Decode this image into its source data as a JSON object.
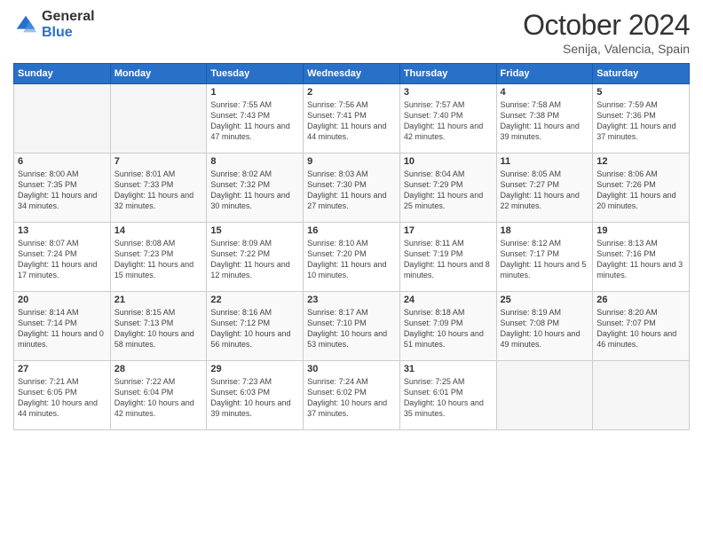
{
  "logo": {
    "general": "General",
    "blue": "Blue"
  },
  "header": {
    "month": "October 2024",
    "location": "Senija, Valencia, Spain"
  },
  "weekdays": [
    "Sunday",
    "Monday",
    "Tuesday",
    "Wednesday",
    "Thursday",
    "Friday",
    "Saturday"
  ],
  "weeks": [
    [
      {
        "day": "",
        "sunrise": "",
        "sunset": "",
        "daylight": "",
        "empty": true
      },
      {
        "day": "",
        "sunrise": "",
        "sunset": "",
        "daylight": "",
        "empty": true
      },
      {
        "day": "1",
        "sunrise": "Sunrise: 7:55 AM",
        "sunset": "Sunset: 7:43 PM",
        "daylight": "Daylight: 11 hours and 47 minutes.",
        "empty": false
      },
      {
        "day": "2",
        "sunrise": "Sunrise: 7:56 AM",
        "sunset": "Sunset: 7:41 PM",
        "daylight": "Daylight: 11 hours and 44 minutes.",
        "empty": false
      },
      {
        "day": "3",
        "sunrise": "Sunrise: 7:57 AM",
        "sunset": "Sunset: 7:40 PM",
        "daylight": "Daylight: 11 hours and 42 minutes.",
        "empty": false
      },
      {
        "day": "4",
        "sunrise": "Sunrise: 7:58 AM",
        "sunset": "Sunset: 7:38 PM",
        "daylight": "Daylight: 11 hours and 39 minutes.",
        "empty": false
      },
      {
        "day": "5",
        "sunrise": "Sunrise: 7:59 AM",
        "sunset": "Sunset: 7:36 PM",
        "daylight": "Daylight: 11 hours and 37 minutes.",
        "empty": false
      }
    ],
    [
      {
        "day": "6",
        "sunrise": "Sunrise: 8:00 AM",
        "sunset": "Sunset: 7:35 PM",
        "daylight": "Daylight: 11 hours and 34 minutes.",
        "empty": false
      },
      {
        "day": "7",
        "sunrise": "Sunrise: 8:01 AM",
        "sunset": "Sunset: 7:33 PM",
        "daylight": "Daylight: 11 hours and 32 minutes.",
        "empty": false
      },
      {
        "day": "8",
        "sunrise": "Sunrise: 8:02 AM",
        "sunset": "Sunset: 7:32 PM",
        "daylight": "Daylight: 11 hours and 30 minutes.",
        "empty": false
      },
      {
        "day": "9",
        "sunrise": "Sunrise: 8:03 AM",
        "sunset": "Sunset: 7:30 PM",
        "daylight": "Daylight: 11 hours and 27 minutes.",
        "empty": false
      },
      {
        "day": "10",
        "sunrise": "Sunrise: 8:04 AM",
        "sunset": "Sunset: 7:29 PM",
        "daylight": "Daylight: 11 hours and 25 minutes.",
        "empty": false
      },
      {
        "day": "11",
        "sunrise": "Sunrise: 8:05 AM",
        "sunset": "Sunset: 7:27 PM",
        "daylight": "Daylight: 11 hours and 22 minutes.",
        "empty": false
      },
      {
        "day": "12",
        "sunrise": "Sunrise: 8:06 AM",
        "sunset": "Sunset: 7:26 PM",
        "daylight": "Daylight: 11 hours and 20 minutes.",
        "empty": false
      }
    ],
    [
      {
        "day": "13",
        "sunrise": "Sunrise: 8:07 AM",
        "sunset": "Sunset: 7:24 PM",
        "daylight": "Daylight: 11 hours and 17 minutes.",
        "empty": false
      },
      {
        "day": "14",
        "sunrise": "Sunrise: 8:08 AM",
        "sunset": "Sunset: 7:23 PM",
        "daylight": "Daylight: 11 hours and 15 minutes.",
        "empty": false
      },
      {
        "day": "15",
        "sunrise": "Sunrise: 8:09 AM",
        "sunset": "Sunset: 7:22 PM",
        "daylight": "Daylight: 11 hours and 12 minutes.",
        "empty": false
      },
      {
        "day": "16",
        "sunrise": "Sunrise: 8:10 AM",
        "sunset": "Sunset: 7:20 PM",
        "daylight": "Daylight: 11 hours and 10 minutes.",
        "empty": false
      },
      {
        "day": "17",
        "sunrise": "Sunrise: 8:11 AM",
        "sunset": "Sunset: 7:19 PM",
        "daylight": "Daylight: 11 hours and 8 minutes.",
        "empty": false
      },
      {
        "day": "18",
        "sunrise": "Sunrise: 8:12 AM",
        "sunset": "Sunset: 7:17 PM",
        "daylight": "Daylight: 11 hours and 5 minutes.",
        "empty": false
      },
      {
        "day": "19",
        "sunrise": "Sunrise: 8:13 AM",
        "sunset": "Sunset: 7:16 PM",
        "daylight": "Daylight: 11 hours and 3 minutes.",
        "empty": false
      }
    ],
    [
      {
        "day": "20",
        "sunrise": "Sunrise: 8:14 AM",
        "sunset": "Sunset: 7:14 PM",
        "daylight": "Daylight: 11 hours and 0 minutes.",
        "empty": false
      },
      {
        "day": "21",
        "sunrise": "Sunrise: 8:15 AM",
        "sunset": "Sunset: 7:13 PM",
        "daylight": "Daylight: 10 hours and 58 minutes.",
        "empty": false
      },
      {
        "day": "22",
        "sunrise": "Sunrise: 8:16 AM",
        "sunset": "Sunset: 7:12 PM",
        "daylight": "Daylight: 10 hours and 56 minutes.",
        "empty": false
      },
      {
        "day": "23",
        "sunrise": "Sunrise: 8:17 AM",
        "sunset": "Sunset: 7:10 PM",
        "daylight": "Daylight: 10 hours and 53 minutes.",
        "empty": false
      },
      {
        "day": "24",
        "sunrise": "Sunrise: 8:18 AM",
        "sunset": "Sunset: 7:09 PM",
        "daylight": "Daylight: 10 hours and 51 minutes.",
        "empty": false
      },
      {
        "day": "25",
        "sunrise": "Sunrise: 8:19 AM",
        "sunset": "Sunset: 7:08 PM",
        "daylight": "Daylight: 10 hours and 49 minutes.",
        "empty": false
      },
      {
        "day": "26",
        "sunrise": "Sunrise: 8:20 AM",
        "sunset": "Sunset: 7:07 PM",
        "daylight": "Daylight: 10 hours and 46 minutes.",
        "empty": false
      }
    ],
    [
      {
        "day": "27",
        "sunrise": "Sunrise: 7:21 AM",
        "sunset": "Sunset: 6:05 PM",
        "daylight": "Daylight: 10 hours and 44 minutes.",
        "empty": false
      },
      {
        "day": "28",
        "sunrise": "Sunrise: 7:22 AM",
        "sunset": "Sunset: 6:04 PM",
        "daylight": "Daylight: 10 hours and 42 minutes.",
        "empty": false
      },
      {
        "day": "29",
        "sunrise": "Sunrise: 7:23 AM",
        "sunset": "Sunset: 6:03 PM",
        "daylight": "Daylight: 10 hours and 39 minutes.",
        "empty": false
      },
      {
        "day": "30",
        "sunrise": "Sunrise: 7:24 AM",
        "sunset": "Sunset: 6:02 PM",
        "daylight": "Daylight: 10 hours and 37 minutes.",
        "empty": false
      },
      {
        "day": "31",
        "sunrise": "Sunrise: 7:25 AM",
        "sunset": "Sunset: 6:01 PM",
        "daylight": "Daylight: 10 hours and 35 minutes.",
        "empty": false
      },
      {
        "day": "",
        "sunrise": "",
        "sunset": "",
        "daylight": "",
        "empty": true
      },
      {
        "day": "",
        "sunrise": "",
        "sunset": "",
        "daylight": "",
        "empty": true
      }
    ]
  ]
}
